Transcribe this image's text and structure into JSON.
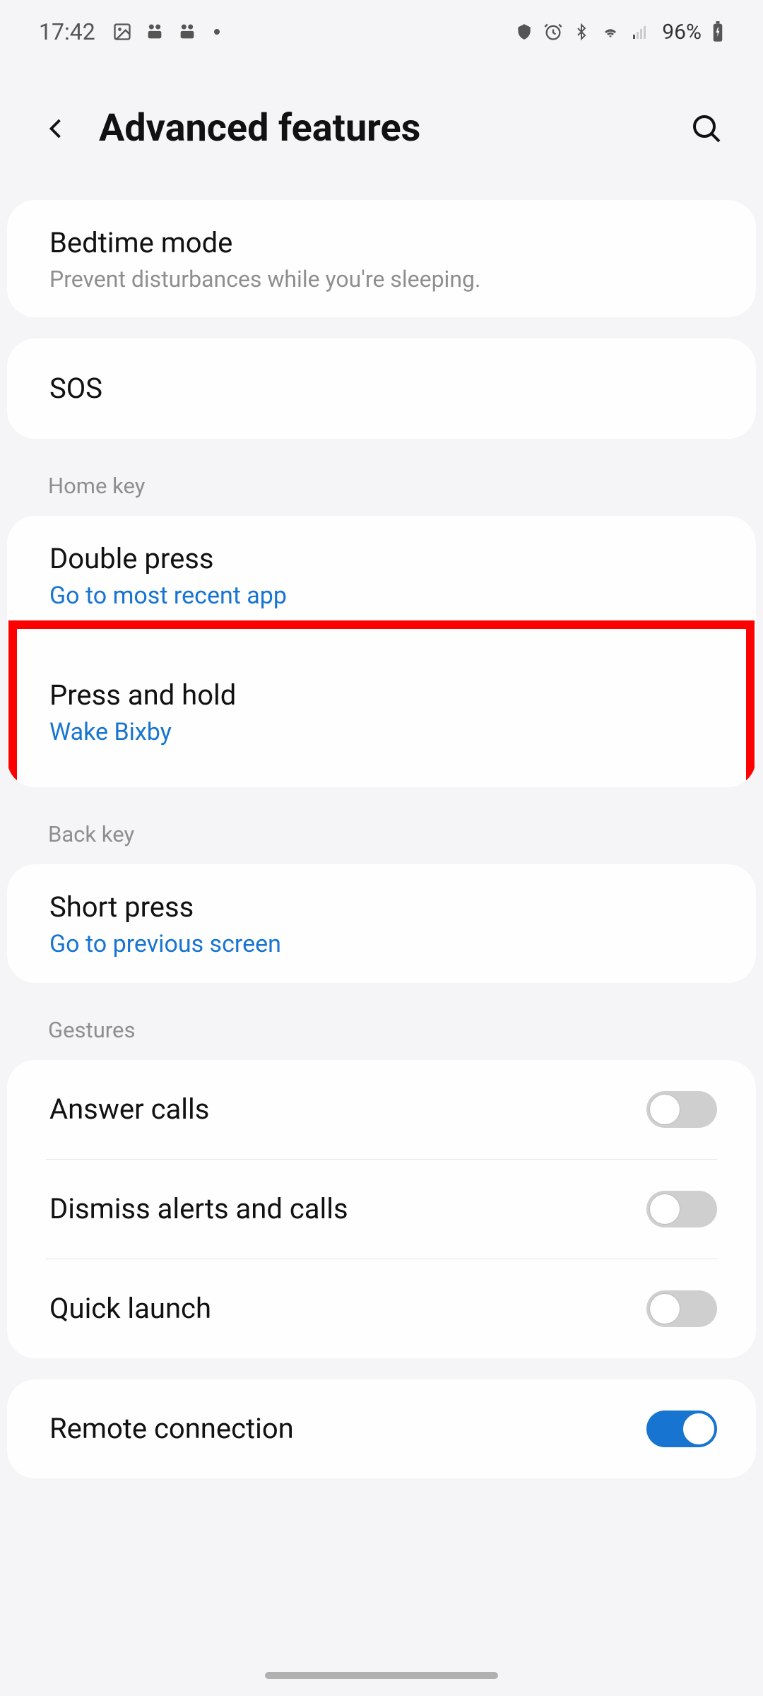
{
  "status": {
    "time": "17:42",
    "battery_pct": "96%"
  },
  "header": {
    "title": "Advanced features"
  },
  "bedtime": {
    "title": "Bedtime mode",
    "subtitle": "Prevent disturbances while you're sleeping."
  },
  "sos": {
    "title": "SOS"
  },
  "home_key_label": "Home key",
  "double_press": {
    "title": "Double press",
    "value": "Go to most recent app"
  },
  "press_hold": {
    "title": "Press and hold",
    "value": "Wake Bixby"
  },
  "back_key_label": "Back key",
  "short_press": {
    "title": "Short press",
    "value": "Go to previous screen"
  },
  "gestures_label": "Gestures",
  "answer_calls": {
    "title": "Answer calls",
    "on": false
  },
  "dismiss_alerts": {
    "title": "Dismiss alerts and calls",
    "on": false
  },
  "quick_launch": {
    "title": "Quick launch",
    "on": false
  },
  "remote_connection": {
    "title": "Remote connection",
    "on": true
  }
}
